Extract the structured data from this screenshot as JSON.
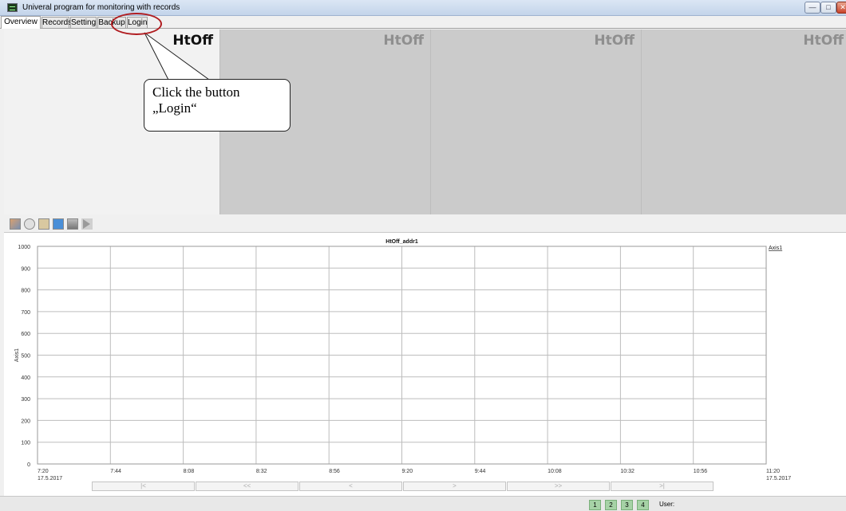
{
  "window": {
    "title": "Univeral program for monitoring with records",
    "icon": "terminal-icon"
  },
  "tabs": [
    "Overview",
    "Records",
    "Setting",
    "Backup",
    "Login"
  ],
  "panels": [
    {
      "label": "HtOff",
      "active": true
    },
    {
      "label": "HtOff",
      "active": false
    },
    {
      "label": "HtOff",
      "active": false
    },
    {
      "label": "HtOff",
      "active": false
    }
  ],
  "annotation": {
    "text_line1": "Click the button",
    "text_line2": "„Login“",
    "highlight_color": "#b01c20"
  },
  "toolbar": {
    "icons": [
      "chart-icon",
      "refresh-icon",
      "book-icon",
      "database-icon",
      "printer-icon",
      "export-icon"
    ]
  },
  "chart_data": {
    "type": "line",
    "title": "HtOff_addr1",
    "ylabel": "Axis1",
    "legend": "Axis1",
    "legend_position": "right",
    "ylim": [
      0,
      1000
    ],
    "yticks": [
      "0",
      "100",
      "200",
      "300",
      "400",
      "500",
      "600",
      "700",
      "800",
      "900",
      "1000"
    ],
    "xticks": [
      {
        "time": "7:20",
        "date": "17.5.2017"
      },
      {
        "time": "7:44",
        "date": ""
      },
      {
        "time": "8:08",
        "date": ""
      },
      {
        "time": "8:32",
        "date": ""
      },
      {
        "time": "8:56",
        "date": ""
      },
      {
        "time": "9:20",
        "date": ""
      },
      {
        "time": "9:44",
        "date": ""
      },
      {
        "time": "10:08",
        "date": ""
      },
      {
        "time": "10:32",
        "date": ""
      },
      {
        "time": "10:56",
        "date": ""
      },
      {
        "time": "11:20",
        "date": "17.5.2017"
      }
    ],
    "series": [],
    "grid": true
  },
  "navigation": [
    "|<",
    "<<",
    "<",
    ">",
    ">>",
    ">|"
  ],
  "status": {
    "pages": [
      "1",
      "2",
      "3",
      "4"
    ],
    "user_label": "User:"
  }
}
